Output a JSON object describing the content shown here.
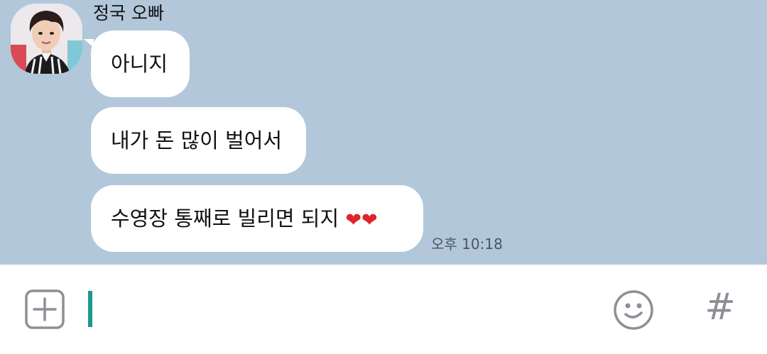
{
  "chat": {
    "sender_name": "정국 오빠",
    "messages": [
      {
        "text": "아니지",
        "hearts": []
      },
      {
        "text": "내가 돈 많이 벌어서",
        "hearts": []
      },
      {
        "text": "수영장 통째로 빌리면 되지 ",
        "hearts": [
          "❤",
          "❤"
        ]
      }
    ],
    "timestamp": "오후 10:18"
  },
  "input_bar": {
    "attach_icon": "plus-icon",
    "message_value": "",
    "emoji_icon": "emoticon-icon",
    "hash_label": "#"
  },
  "colors": {
    "chat_background": "#b2c7da",
    "bubble": "#ffffff",
    "cursor": "#1a9a8c",
    "heart": "#e0242c"
  }
}
